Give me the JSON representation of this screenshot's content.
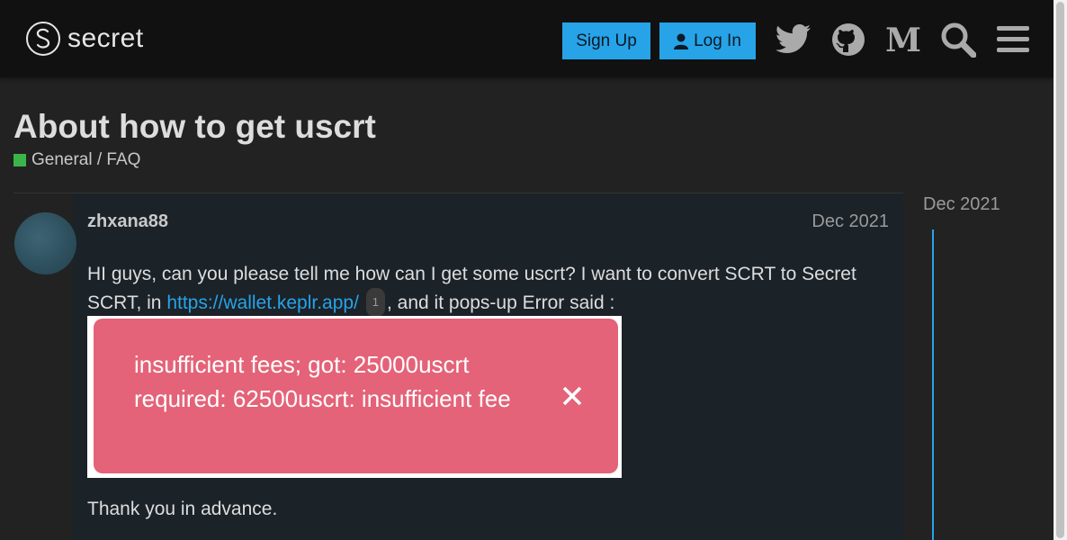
{
  "header": {
    "logo_text": "secret",
    "signup_label": "Sign Up",
    "login_label": "Log In",
    "icons": [
      "twitter-icon",
      "github-icon",
      "medium-icon",
      "search-icon",
      "hamburger-menu-icon"
    ],
    "accent_color": "#27a3e8"
  },
  "topic": {
    "title": "About how to get uscrt",
    "category": "General / FAQ",
    "category_color": "#3ab54a"
  },
  "post": {
    "username": "zhxana88",
    "date": "Dec 2021",
    "text_before_link": "HI guys, can you please tell me how can I get some uscrt? I want to convert SCRT to Secret SCRT, in ",
    "link_text": "https://wallet.keplr.app/",
    "link_clicks": "1",
    "text_after_link": ", and it pops-up Error said :",
    "image_error_text": "insufficient fees; got: 25000uscrt required: 62500uscrt: insufficient fee",
    "closing": "Thank you in advance."
  },
  "timeline": {
    "date": "Dec 2021"
  }
}
